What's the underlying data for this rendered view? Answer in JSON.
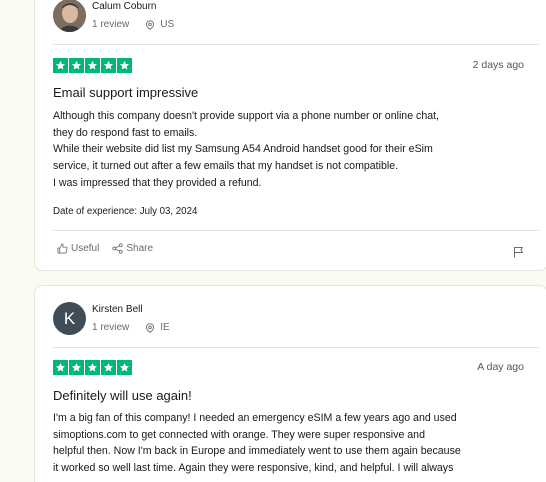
{
  "reviews": [
    {
      "reviewer_name": "Calum Coburn",
      "review_count": "1 review",
      "country": "US",
      "avatar_initial": "",
      "date": "2 days ago",
      "rating": 5,
      "title": "Email support impressive",
      "body_lines": [
        "Although this company doesn't provide support via a phone number or online chat,",
        "they do respond fast to emails.",
        "While their website did list my Samsung A54 Android handset good for their eSim",
        "service, it turned out after a few emails that my handset is not compatible.",
        "I was impressed that they provided a refund."
      ],
      "experience_label": "Date of experience:",
      "experience_date": "July 03, 2024",
      "useful_label": "Useful",
      "share_label": "Share"
    },
    {
      "reviewer_name": "Kirsten Bell",
      "review_count": "1 review",
      "country": "IE",
      "avatar_initial": "K",
      "date": "A day ago",
      "rating": 5,
      "title": "Definitely will use again!",
      "body_lines": [
        "I'm a big fan of this company! I needed an emergency eSIM a few years ago and used",
        "simoptions.com to get connected with orange. They were super responsive and",
        "helpful then. Now I'm back in Europe and immediately went to use them again because",
        "it worked so well last time. Again they were responsive, kind, and helpful. I will always"
      ]
    }
  ],
  "colors": {
    "star_green": "#00b67a",
    "page_bg": "#fcfbf3",
    "avatar_dark": "#3e4d57"
  }
}
